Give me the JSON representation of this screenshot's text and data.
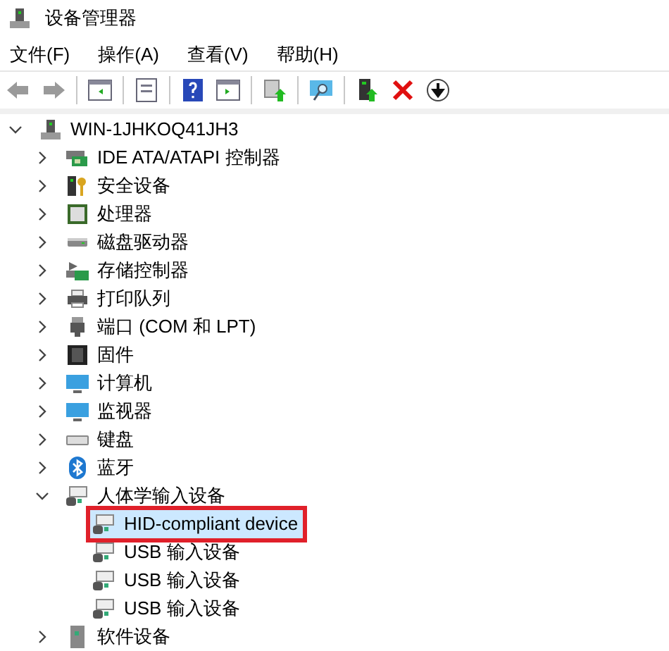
{
  "window": {
    "title": "设备管理器"
  },
  "menu": [
    "文件(F)",
    "操作(A)",
    "查看(V)",
    "帮助(H)"
  ],
  "toolbar": [
    {
      "kind": "back"
    },
    {
      "kind": "forward"
    },
    {
      "kind": "sep"
    },
    {
      "kind": "panel-left"
    },
    {
      "kind": "sep"
    },
    {
      "kind": "properties"
    },
    {
      "kind": "sep"
    },
    {
      "kind": "help"
    },
    {
      "kind": "panel-right"
    },
    {
      "kind": "sep"
    },
    {
      "kind": "update"
    },
    {
      "kind": "sep"
    },
    {
      "kind": "scan"
    },
    {
      "kind": "sep"
    },
    {
      "kind": "enable"
    },
    {
      "kind": "remove"
    },
    {
      "kind": "download"
    }
  ],
  "tree": [
    {
      "label": "WIN-1JHKOQ41JH3",
      "kind": "computer",
      "expanded": true,
      "selected": false,
      "children": [
        {
          "label": "IDE ATA/ATAPI 控制器",
          "kind": "controller",
          "expanded": false,
          "selected": false
        },
        {
          "label": "安全设备",
          "kind": "security",
          "expanded": false,
          "selected": false
        },
        {
          "label": "处理器",
          "kind": "cpu",
          "expanded": false,
          "selected": false
        },
        {
          "label": "磁盘驱动器",
          "kind": "disk",
          "expanded": false,
          "selected": false
        },
        {
          "label": "存储控制器",
          "kind": "storage",
          "expanded": false,
          "selected": false
        },
        {
          "label": "打印队列",
          "kind": "printer",
          "expanded": false,
          "selected": false
        },
        {
          "label": "端口 (COM 和 LPT)",
          "kind": "port",
          "expanded": false,
          "selected": false
        },
        {
          "label": "固件",
          "kind": "firmware",
          "expanded": false,
          "selected": false
        },
        {
          "label": "计算机",
          "kind": "monitor",
          "expanded": false,
          "selected": false
        },
        {
          "label": "监视器",
          "kind": "monitor",
          "expanded": false,
          "selected": false
        },
        {
          "label": "键盘",
          "kind": "keyboard",
          "expanded": false,
          "selected": false
        },
        {
          "label": "蓝牙",
          "kind": "bluetooth",
          "expanded": false,
          "selected": false
        },
        {
          "label": "人体学输入设备",
          "kind": "hid",
          "expanded": true,
          "selected": false,
          "children": [
            {
              "label": "HID-compliant device",
              "kind": "hid",
              "selected": true,
              "marked": true
            },
            {
              "label": "USB 输入设备",
              "kind": "hid",
              "selected": false,
              "marked": false
            },
            {
              "label": "USB 输入设备",
              "kind": "hid",
              "selected": false,
              "marked": false
            },
            {
              "label": "USB 输入设备",
              "kind": "hid",
              "selected": false,
              "marked": false
            }
          ]
        },
        {
          "label": "软件设备",
          "kind": "software",
          "expanded": false,
          "selected": false
        }
      ]
    }
  ]
}
